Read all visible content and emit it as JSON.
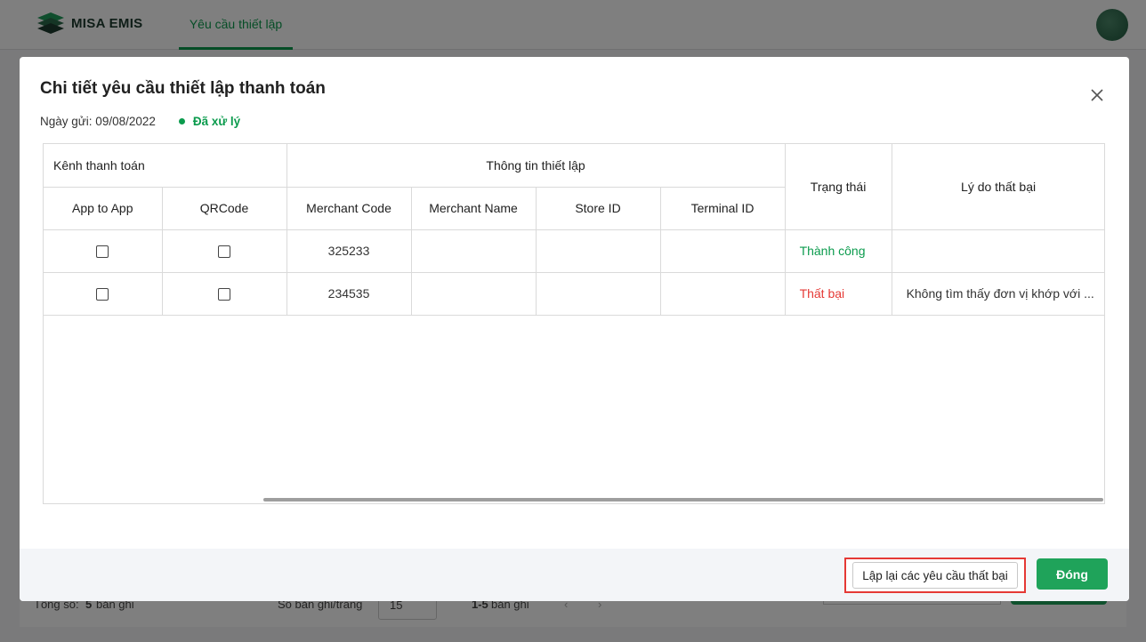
{
  "app": {
    "brand": "MISA EMIS",
    "nav_tab": "Yêu cầu thiết lập"
  },
  "background_footer": {
    "total_label": "Tổng số:",
    "total_value": "5",
    "total_unit": "bản ghi",
    "per_page_label": "Số bản ghi/trang",
    "per_page_value": "15",
    "range": "1-5",
    "range_unit": "bản ghi"
  },
  "dialog": {
    "title": "Chi tiết yêu cầu thiết lập thanh toán",
    "sent_date_label": "Ngày gửi: 09/08/2022",
    "status": "Đã xử lý",
    "table": {
      "group_channel": "Kênh thanh toán",
      "group_info": "Thông tin thiết lập",
      "col_status": "Trạng thái",
      "col_reason": "Lý do thất bại",
      "col_app": "App to App",
      "col_qr": "QRCode",
      "col_merchant_code": "Merchant Code",
      "col_merchant_name": "Merchant Name",
      "col_store": "Store ID",
      "col_terminal": "Terminal ID",
      "rows": [
        {
          "app": false,
          "qr": false,
          "merchant_code": "325233",
          "merchant_name": "",
          "store": "",
          "terminal": "",
          "status": "Thành công",
          "reason": ""
        },
        {
          "app": false,
          "qr": false,
          "merchant_code": "234535",
          "merchant_name": "",
          "store": "",
          "terminal": "",
          "status": "Thất bại",
          "reason": "Không tìm thấy đơn vị khớp với ..."
        }
      ]
    },
    "retry_button": "Lập lại các yêu cầu thất bại",
    "close_button": "Đóng"
  },
  "colors": {
    "accent": "#0b9b4d",
    "error": "#e53935",
    "button": "#1fa35a"
  }
}
